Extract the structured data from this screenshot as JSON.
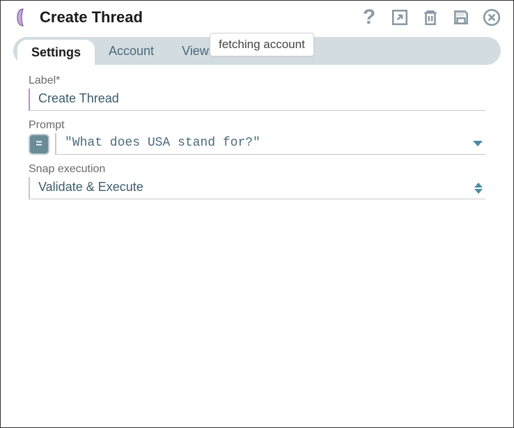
{
  "window": {
    "title": "Create Thread"
  },
  "toolbar": {
    "help": "?",
    "export": "export",
    "delete": "delete",
    "save": "save",
    "close": "close"
  },
  "tabs": [
    {
      "id": "settings",
      "label": "Settings",
      "active": true
    },
    {
      "id": "account",
      "label": "Account",
      "active": false
    },
    {
      "id": "views",
      "label": "Views",
      "active": false
    }
  ],
  "tooltip": "fetching account",
  "form": {
    "label_field": {
      "label": "Label*",
      "value": "Create Thread"
    },
    "prompt_field": {
      "label": "Prompt",
      "badge": "=",
      "value": "\"What does USA stand for?\""
    },
    "snap_execution_field": {
      "label": "Snap execution",
      "value": "Validate & Execute"
    }
  },
  "colors": {
    "accent_purple": "#b88bd6",
    "tab_bg": "#d3dce0",
    "text_muted": "#4a6b7a",
    "icon_grey": "#8a9aa3"
  }
}
